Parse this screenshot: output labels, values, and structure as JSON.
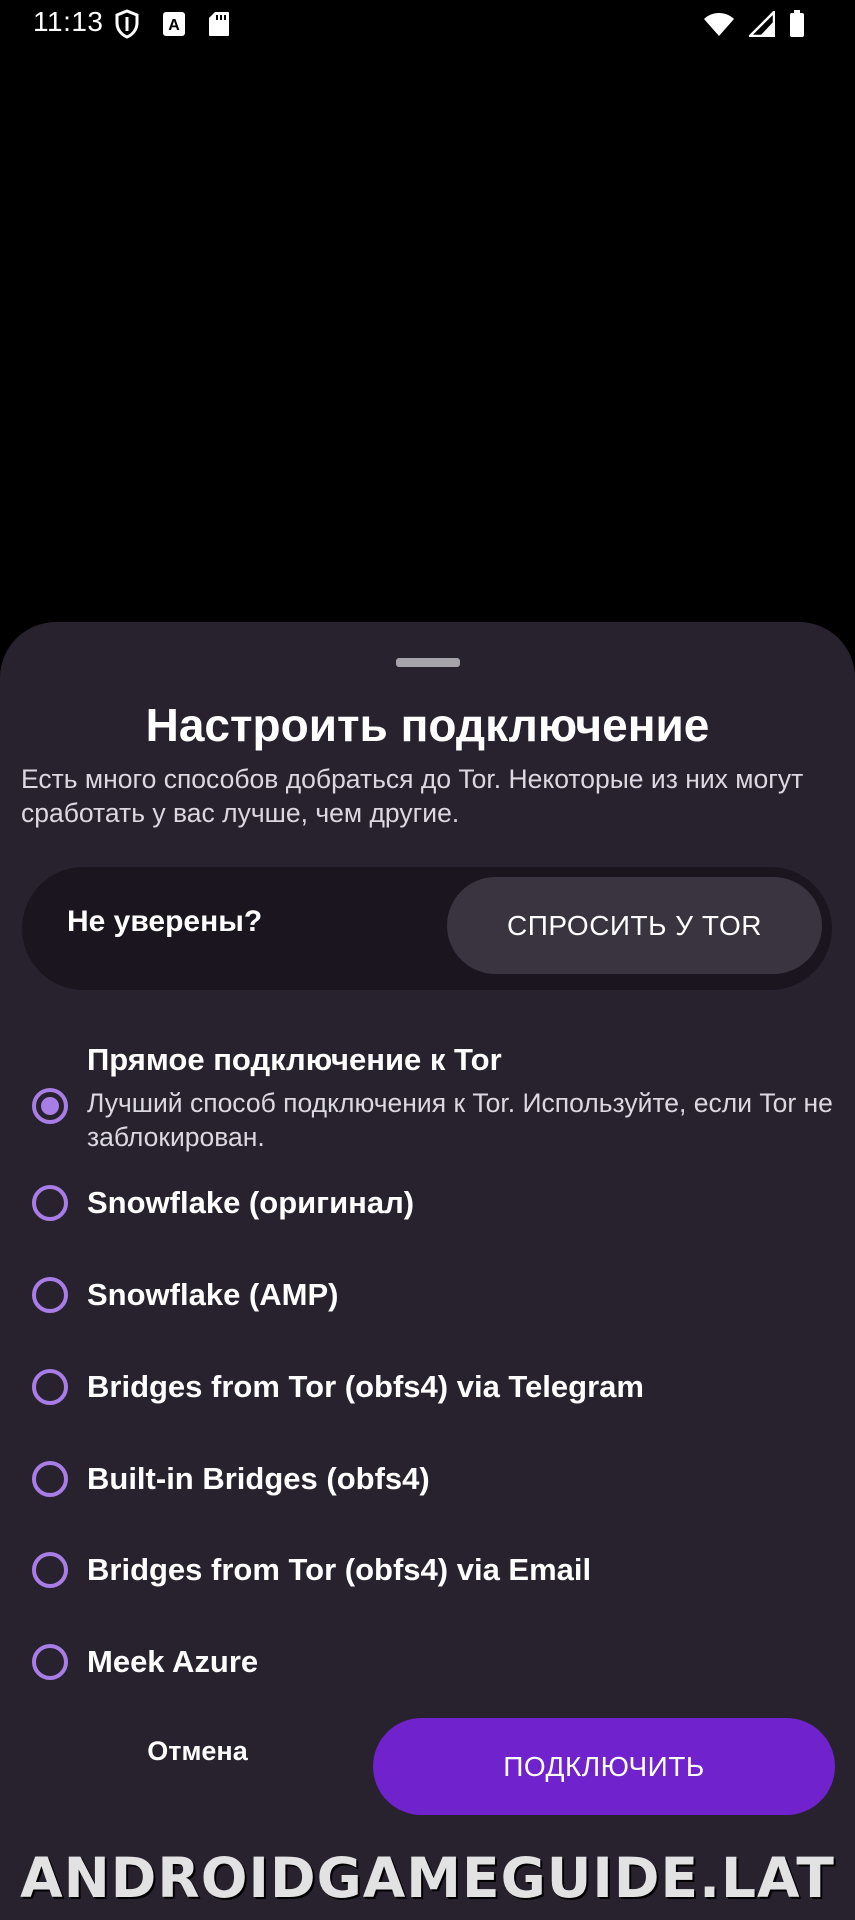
{
  "status_bar": {
    "time": "11:13",
    "left_icons": [
      "shield-icon",
      "font-a-icon",
      "sd-card-icon"
    ],
    "right_icons": [
      "wifi-icon",
      "cell-signal-icon",
      "battery-icon"
    ]
  },
  "sheet": {
    "title": "Настроить подключение",
    "description": "Есть много способов добраться до Tor. Некоторые из них могут сработать у вас лучше, чем другие.",
    "help_card": {
      "label": "Не уверены?",
      "button": "СПРОСИТЬ У TOR"
    },
    "options": [
      {
        "title": "Прямое подключение к Tor",
        "description": "Лучший способ подключения к Tor. Используйте, если Tor не заблокирован.",
        "selected": true
      },
      {
        "title": "Snowflake (оригинал)",
        "description": "",
        "selected": false
      },
      {
        "title": "Snowflake (AMP)",
        "description": "",
        "selected": false
      },
      {
        "title": "Bridges from Tor (obfs4) via Telegram",
        "description": "",
        "selected": false
      },
      {
        "title": "Built-in Bridges (obfs4)",
        "description": "",
        "selected": false
      },
      {
        "title": "Bridges from Tor (obfs4) via Email",
        "description": "",
        "selected": false
      },
      {
        "title": "Meek Azure",
        "description": "",
        "selected": false
      }
    ],
    "cancel_label": "Отмена",
    "connect_label": "ПОДКЛЮЧИТЬ"
  },
  "colors": {
    "sheet_bg": "#28222f",
    "card_bg": "#1b1520",
    "accent": "#7022cc",
    "radio": "#a97de6"
  },
  "watermark": "ANDROIDGAMEGUIDE.LAT"
}
